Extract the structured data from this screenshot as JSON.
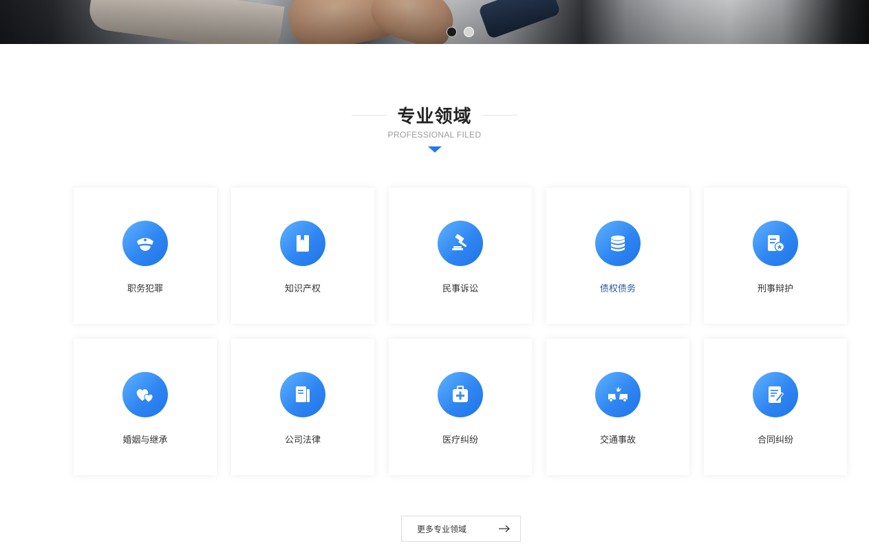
{
  "banner": {
    "dots": [
      {
        "active": true
      },
      {
        "active": false
      }
    ]
  },
  "section": {
    "title": "专业领域",
    "subtitle": "PROFESSIONAL FILED"
  },
  "cards": [
    {
      "label": "职务犯罪",
      "icon": "police-cap-icon"
    },
    {
      "label": "知识产权",
      "icon": "book-icon"
    },
    {
      "label": "民事诉讼",
      "icon": "gavel-icon"
    },
    {
      "label": "债权债务",
      "icon": "coin-stack-icon"
    },
    {
      "label": "刑事辩护",
      "icon": "document-badge-icon"
    },
    {
      "label": "婚姻与继承",
      "icon": "hearts-icon"
    },
    {
      "label": "公司法律",
      "icon": "documents-icon"
    },
    {
      "label": "医疗纠纷",
      "icon": "medical-kit-icon"
    },
    {
      "label": "交通事故",
      "icon": "car-crash-icon"
    },
    {
      "label": "合同纠纷",
      "icon": "contract-edit-icon"
    }
  ],
  "more_button": {
    "label": "更多专业领域"
  },
  "colors": {
    "accent": "#1e7be6",
    "icon_gradient_start": "#5eb2ff",
    "icon_gradient_end": "#1f74e6",
    "highlight_label": "#2a5a9e"
  }
}
